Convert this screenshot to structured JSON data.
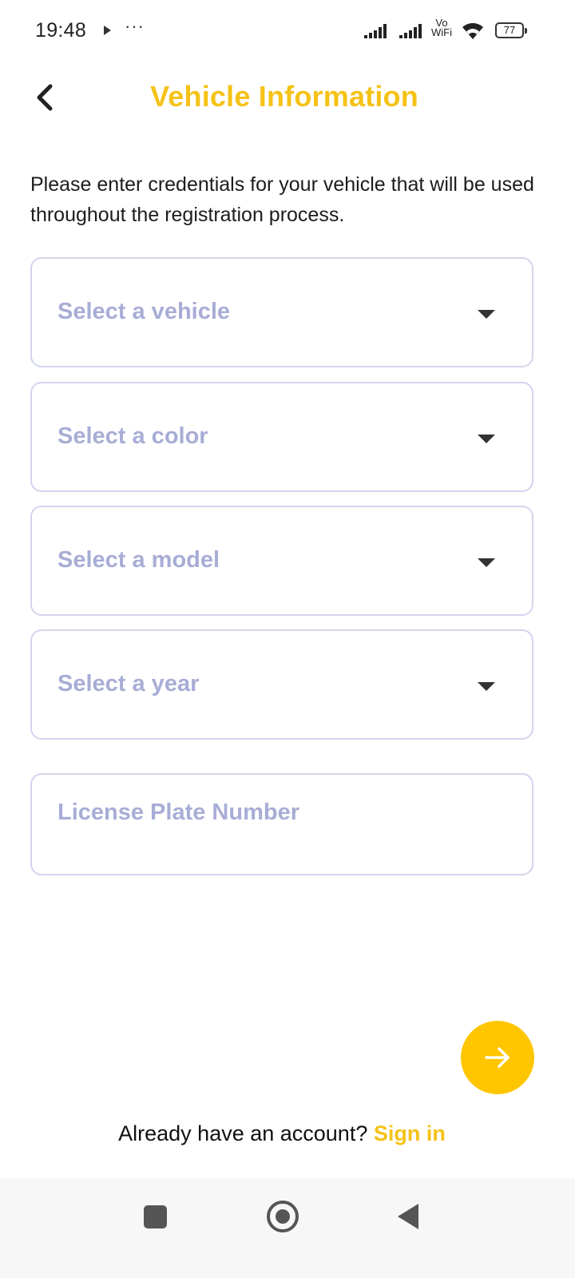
{
  "status_bar": {
    "time": "19:48",
    "more": "···",
    "vo": "Vo",
    "wifi_label": "WiFi",
    "battery": "77"
  },
  "header": {
    "title": "Vehicle Information"
  },
  "intro_text": "Please enter credentials for your vehicle that will be used throughout the registration process.",
  "form": {
    "vehicle_placeholder": "Select a vehicle",
    "color_placeholder": "Select a color",
    "model_placeholder": "Select a model",
    "year_placeholder": "Select a year",
    "plate_placeholder": "License Plate Number"
  },
  "footer": {
    "question": "Already have an account?",
    "signin": "Sign in"
  },
  "colors": {
    "accent": "#F5C216",
    "button": "#FFC600",
    "placeholder": "#A8ADD6",
    "border": "#D2D5EE"
  },
  "icons": [
    "back-arrow-icon",
    "chevron-down-icon",
    "arrow-right-icon",
    "wifi-icon",
    "signal-icon",
    "battery-icon"
  ]
}
